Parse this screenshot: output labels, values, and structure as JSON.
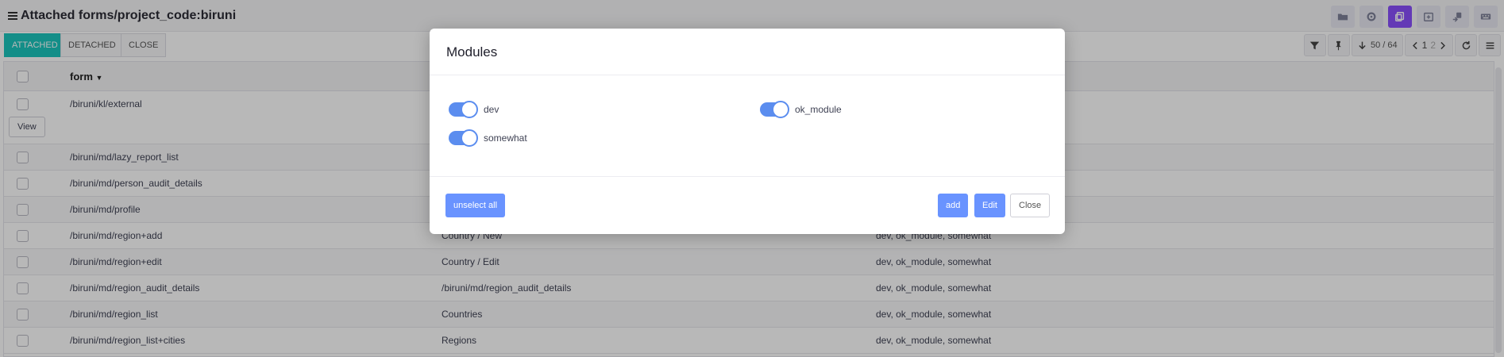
{
  "header": {
    "title": "Attached forms/project_code:biruni"
  },
  "top_icons": [
    "folder-icon",
    "settings-icon",
    "copy-icon",
    "calendar-icon",
    "transfer-icon",
    "keyboard-icon"
  ],
  "tabs": [
    {
      "label": "ATTACHED",
      "active": true
    },
    {
      "label": "DETACHED",
      "active": false
    },
    {
      "label": "CLOSE",
      "active": false
    }
  ],
  "toolbar": {
    "counter": "50 / 64",
    "page_current": "1",
    "page_next": "2"
  },
  "grid": {
    "form_header": "form",
    "view_label": "View",
    "rows": [
      {
        "form": "/biruni/kl/external",
        "name": "",
        "modules": ""
      },
      {
        "form": "/biruni/md/lazy_report_list",
        "name": "",
        "modules": ""
      },
      {
        "form": "/biruni/md/person_audit_details",
        "name": "",
        "modules": ""
      },
      {
        "form": "/biruni/md/profile",
        "name": "",
        "modules": ""
      },
      {
        "form": "/biruni/md/region+add",
        "name": "Country / New",
        "modules": "dev, ok_module, somewhat"
      },
      {
        "form": "/biruni/md/region+edit",
        "name": "Country / Edit",
        "modules": "dev, ok_module, somewhat"
      },
      {
        "form": "/biruni/md/region_audit_details",
        "name": "/biruni/md/region_audit_details",
        "modules": "dev, ok_module, somewhat"
      },
      {
        "form": "/biruni/md/region_list",
        "name": "Countries",
        "modules": "dev, ok_module, somewhat"
      },
      {
        "form": "/biruni/md/region_list+cities",
        "name": "Regions",
        "modules": "dev, ok_module, somewhat"
      }
    ]
  },
  "modal": {
    "title": "Modules",
    "switches": [
      {
        "label": "dev",
        "on": true
      },
      {
        "label": "ok_module",
        "on": true
      },
      {
        "label": "somewhat",
        "on": true
      }
    ],
    "unselect_all": "unselect all",
    "add": "add",
    "edit": "Edit",
    "close": "Close"
  },
  "colors": {
    "accent_teal": "#1bc5bd",
    "accent_purple": "#8950fc",
    "primary_blue": "#6993ff"
  }
}
